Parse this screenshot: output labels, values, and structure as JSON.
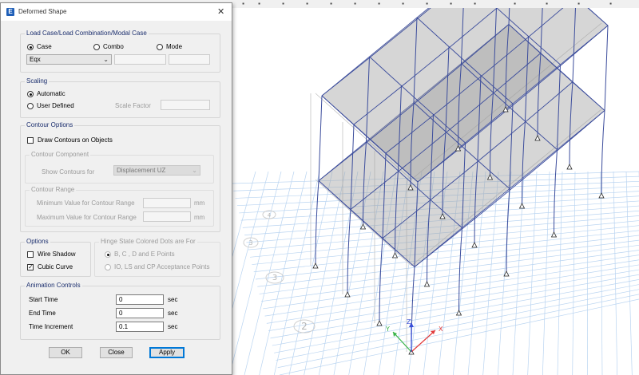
{
  "dialog": {
    "title": "Deformed Shape",
    "load_case": {
      "legend": "Load Case/Load Combination/Modal Case",
      "options": [
        "Case",
        "Combo",
        "Mode"
      ],
      "selected": "Eqx"
    },
    "scaling": {
      "legend": "Scaling",
      "automatic": "Automatic",
      "user_defined": "User Defined",
      "scale_factor_label": "Scale Factor",
      "scale_factor_value": ""
    },
    "contour_options": {
      "legend": "Contour Options",
      "draw_contours": "Draw Contours on Objects",
      "component_legend": "Contour Component",
      "show_contours_for": "Show Contours for",
      "component_value": "Displacement UZ",
      "range_legend": "Contour Range",
      "min_label": "Minimum Value for Contour Range",
      "max_label": "Maximum Value for Contour Range",
      "unit": "mm"
    },
    "options": {
      "legend": "Options",
      "wire_shadow": "Wire Shadow",
      "cubic_curve": "Cubic Curve",
      "hinge_legend": "Hinge State Colored Dots are For",
      "hinge_opt1": "B, C , D and E Points",
      "hinge_opt2": "IO, LS and CP Acceptance Points"
    },
    "animation": {
      "legend": "Animation Controls",
      "start_label": "Start Time",
      "start_value": "0",
      "end_label": "End Time",
      "end_value": "0",
      "increment_label": "Time Increment",
      "increment_value": "0.1",
      "unit": "sec"
    },
    "buttons": {
      "ok": "OK",
      "close": "Close",
      "apply": "Apply"
    }
  },
  "viewport": {
    "grid_bubbles": [
      "1",
      "2",
      "3",
      "4"
    ],
    "axes": {
      "x": "X",
      "y": "Y",
      "z": "Z"
    },
    "colors": {
      "grid": "#b9d4f1",
      "frame": "#3b4c9c",
      "shadow_frame": "#c4c4c4",
      "slab": "#9e9e9e",
      "x_axis": "#e23b3b",
      "y_axis": "#3ab44a",
      "z_axis": "#3a4fd8"
    }
  },
  "close_glyph": "✕",
  "app_icon_letter": "E"
}
